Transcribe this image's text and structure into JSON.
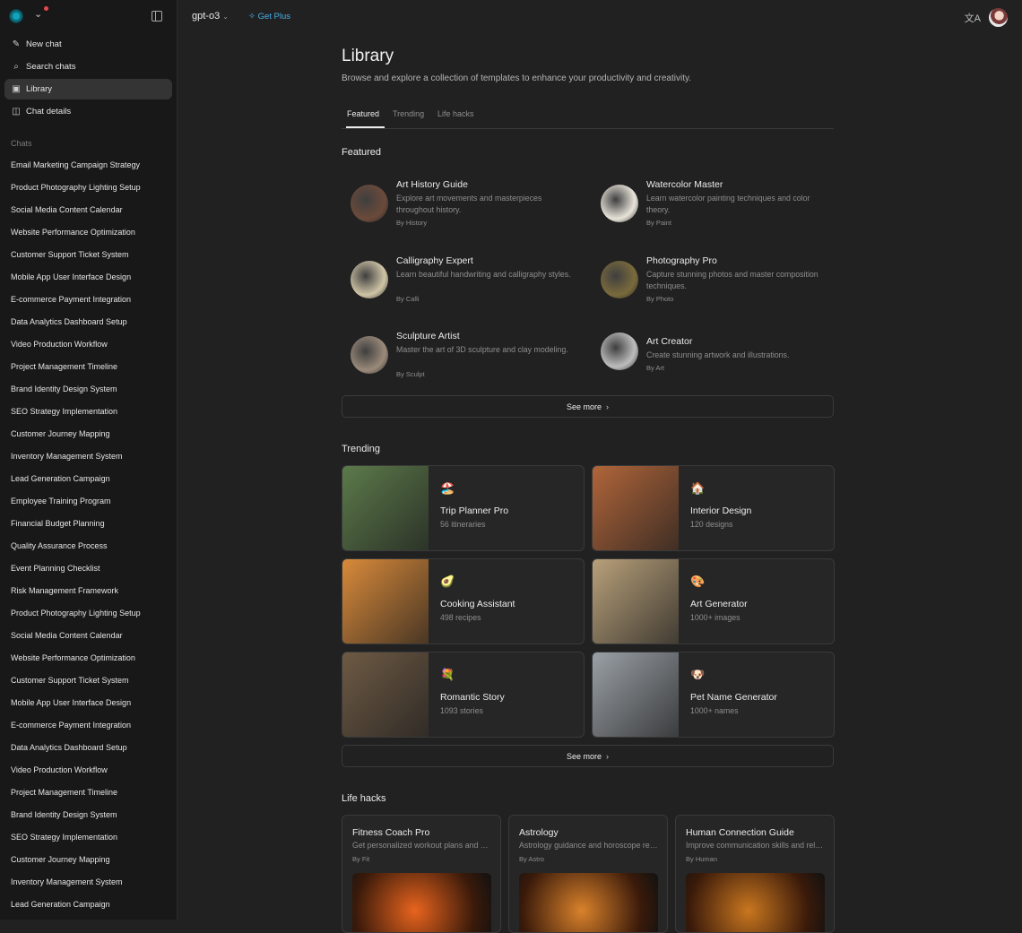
{
  "sidebar": {
    "nav": [
      {
        "icon": "pencil-square",
        "label": "New chat"
      },
      {
        "icon": "⌕",
        "label": "Search chats"
      },
      {
        "icon": "▣",
        "label": "Library"
      },
      {
        "icon": "◫",
        "label": "Chat details"
      }
    ],
    "section_label": "Chats",
    "chats": [
      "Email Marketing Campaign Strategy",
      "Product Photography Lighting Setup",
      "Social Media Content Calendar",
      "Website Performance Optimization",
      "Customer Support Ticket System",
      "Mobile App User Interface Design",
      "E-commerce Payment Integration",
      "Data Analytics Dashboard Setup",
      "Video Production Workflow",
      "Project Management Timeline",
      "Brand Identity Design System",
      "SEO Strategy Implementation",
      "Customer Journey Mapping",
      "Inventory Management System",
      "Lead Generation Campaign",
      "Employee Training Program",
      "Financial Budget Planning",
      "Quality Assurance Process",
      "Event Planning Checklist",
      "Risk Management Framework",
      "Product Photography Lighting Setup",
      "Social Media Content Calendar",
      "Website Performance Optimization",
      "Customer Support Ticket System",
      "Mobile App User Interface Design",
      "E-commerce Payment Integration",
      "Data Analytics Dashboard Setup",
      "Video Production Workflow",
      "Project Management Timeline",
      "Brand Identity Design System",
      "SEO Strategy Implementation",
      "Customer Journey Mapping",
      "Inventory Management System",
      "Lead Generation Campaign"
    ]
  },
  "topbar": {
    "model": "gpt-o3",
    "get_plus": "Get Plus",
    "translate_icon": "文A"
  },
  "page": {
    "title": "Library",
    "subtitle": "Browse and explore a collection of templates to enhance your productivity and creativity.",
    "tabs": [
      "Featured",
      "Trending",
      "Life hacks"
    ]
  },
  "featured": {
    "title": "Featured",
    "items": [
      {
        "title": "Art History Guide",
        "desc": "Explore art movements and masterpieces throughout history.",
        "by": "By History",
        "color": "#6b4a3a"
      },
      {
        "title": "Watercolor Master",
        "desc": "Learn watercolor painting techniques and color theory.",
        "by": "By Paint",
        "color": "#e8e4da"
      },
      {
        "title": "Calligraphy Expert",
        "desc": "Learn beautiful handwriting and calligraphy styles.",
        "by": "By Calli",
        "color": "#cfc4a6"
      },
      {
        "title": "Photography Pro",
        "desc": "Capture stunning photos and master composition techniques.",
        "by": "By Photo",
        "color": "#7a6a3c"
      },
      {
        "title": "Sculpture Artist",
        "desc": "Master the art of 3D sculpture and clay modeling.",
        "by": "By Sculpt",
        "color": "#9a8a7a"
      },
      {
        "title": "Art Creator",
        "desc": "Create stunning artwork and illustrations.",
        "by": "By Art",
        "color": "#bdbdbd"
      }
    ],
    "see_more": "See more"
  },
  "trending": {
    "title": "Trending",
    "items": [
      {
        "emoji": "🏖️",
        "title": "Trip Planner Pro",
        "sub": "56 itineraries",
        "color": "#5c7a4a"
      },
      {
        "emoji": "🏠",
        "title": "Interior Design",
        "sub": "120 designs",
        "color": "#b0653a"
      },
      {
        "emoji": "🥑",
        "title": "Cooking Assistant",
        "sub": "498 recipes",
        "color": "#d98a3a"
      },
      {
        "emoji": "🎨",
        "title": "Art Generator",
        "sub": "1000+ images",
        "color": "#b8a07a"
      },
      {
        "emoji": "💐",
        "title": "Romantic Story",
        "sub": "1093 stories",
        "color": "#6e5a44"
      },
      {
        "emoji": "🐶",
        "title": "Pet Name Generator",
        "sub": "1000+ names",
        "color": "#9aa0a6"
      }
    ],
    "see_more": "See more"
  },
  "life_hacks": {
    "title": "Life hacks",
    "items": [
      {
        "title": "Fitness Coach Pro",
        "desc": "Get personalized workout plans and nutrition advice.",
        "by": "By Fit",
        "color": "#e8641e"
      },
      {
        "title": "Astrology",
        "desc": "Astrology guidance and horoscope readings.",
        "by": "By Astro",
        "color": "#d9822b"
      },
      {
        "title": "Human Connection Guide",
        "desc": "Improve communication skills and relationships.",
        "by": "By Human",
        "color": "#c9771f"
      }
    ]
  }
}
